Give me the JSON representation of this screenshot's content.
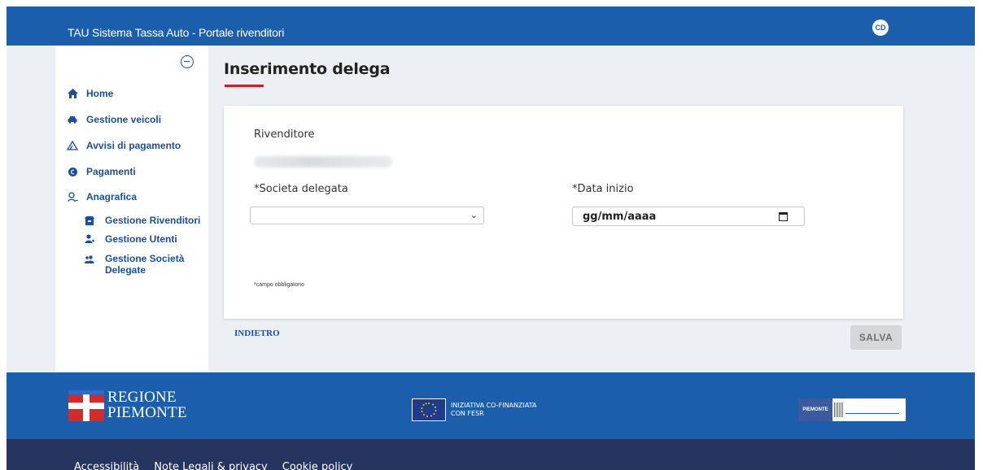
{
  "header": {
    "title": "TAU Sistema Tassa Auto - Portale rivenditori",
    "user_initials": "CD"
  },
  "sidebar": {
    "items": [
      {
        "label": "Home",
        "icon": "home-icon"
      },
      {
        "label": "Gestione veicoli",
        "icon": "car-icon"
      },
      {
        "label": "Avvisi di pagamento",
        "icon": "warning-triangle-icon"
      },
      {
        "label": "Pagamenti",
        "icon": "euro-coin-icon"
      },
      {
        "label": "Anagrafica",
        "icon": "person-icon"
      }
    ],
    "sub_items": [
      {
        "label": "Gestione Rivenditori",
        "icon": "shop-icon"
      },
      {
        "label": "Gestione Utenti",
        "icon": "add-user-icon"
      },
      {
        "label": "Gestione Società Delegate",
        "icon": "group-icon"
      }
    ]
  },
  "main": {
    "title": "Inserimento delega",
    "rivenditore_label": "Rivenditore",
    "societa_label": "*Societa delegata",
    "societa_value": "",
    "data_label": "*Data inizio",
    "data_placeholder": "gg/mm/aaaa",
    "required_note": "*campo obbligatorio",
    "back_label": "INDIETRO",
    "save_label": "SALVA"
  },
  "footer": {
    "region_line1": "REGIONE",
    "region_line2": "PIEMONTE",
    "eu_line1": "INIZIATIVA CO-FINANZIATA",
    "eu_line2": "CON FESR",
    "partner_text": "PIEMONTE",
    "links": [
      "Accessibilità",
      "Note Legali & privacy",
      "Cookie policy"
    ]
  },
  "colors": {
    "primary": "#1b5fac",
    "nav": "#1b4f96",
    "accent": "#c8202a",
    "footer_dark": "#26355f"
  }
}
